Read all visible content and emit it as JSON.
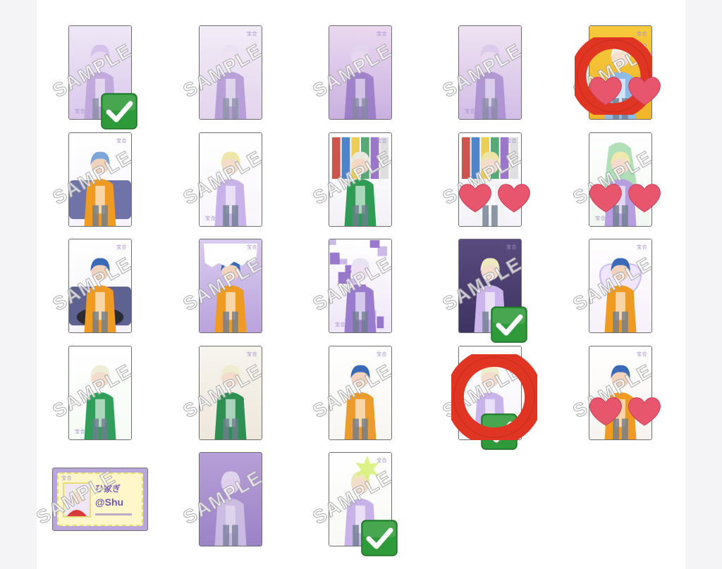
{
  "watermark": "SAMPLE",
  "brand_mark": "宝合",
  "ticket": {
    "title_line": "ひ家ぎ",
    "logo_text": "@Shu"
  },
  "colors": {
    "check": "#2f9a3a",
    "ring": "#e03522",
    "heart": "#e8566e",
    "lavender": "#b9a6da"
  },
  "cards": [
    {
      "name": "photocard-1",
      "status": "owned"
    },
    {
      "name": "photocard-2",
      "status": "none"
    },
    {
      "name": "photocard-3",
      "status": "none"
    },
    {
      "name": "photocard-4",
      "status": "none"
    },
    {
      "name": "photocard-5",
      "status": "wanted-priority"
    },
    {
      "name": "photocard-6",
      "status": "none"
    },
    {
      "name": "photocard-7",
      "status": "none"
    },
    {
      "name": "photocard-8",
      "status": "none"
    },
    {
      "name": "photocard-9",
      "status": "wanted"
    },
    {
      "name": "photocard-10",
      "status": "wanted"
    },
    {
      "name": "photocard-11",
      "status": "none"
    },
    {
      "name": "photocard-12",
      "status": "none"
    },
    {
      "name": "photocard-13",
      "status": "none"
    },
    {
      "name": "photocard-14",
      "status": "owned"
    },
    {
      "name": "photocard-15",
      "status": "none"
    },
    {
      "name": "photocard-16",
      "status": "none"
    },
    {
      "name": "photocard-17",
      "status": "none"
    },
    {
      "name": "photocard-18",
      "status": "none"
    },
    {
      "name": "photocard-19",
      "status": "owned-priority"
    },
    {
      "name": "photocard-20",
      "status": "wanted"
    },
    {
      "name": "ticket-card",
      "status": "none"
    },
    {
      "name": "photocard-22",
      "status": "none"
    },
    {
      "name": "photocard-23",
      "status": "owned"
    }
  ]
}
